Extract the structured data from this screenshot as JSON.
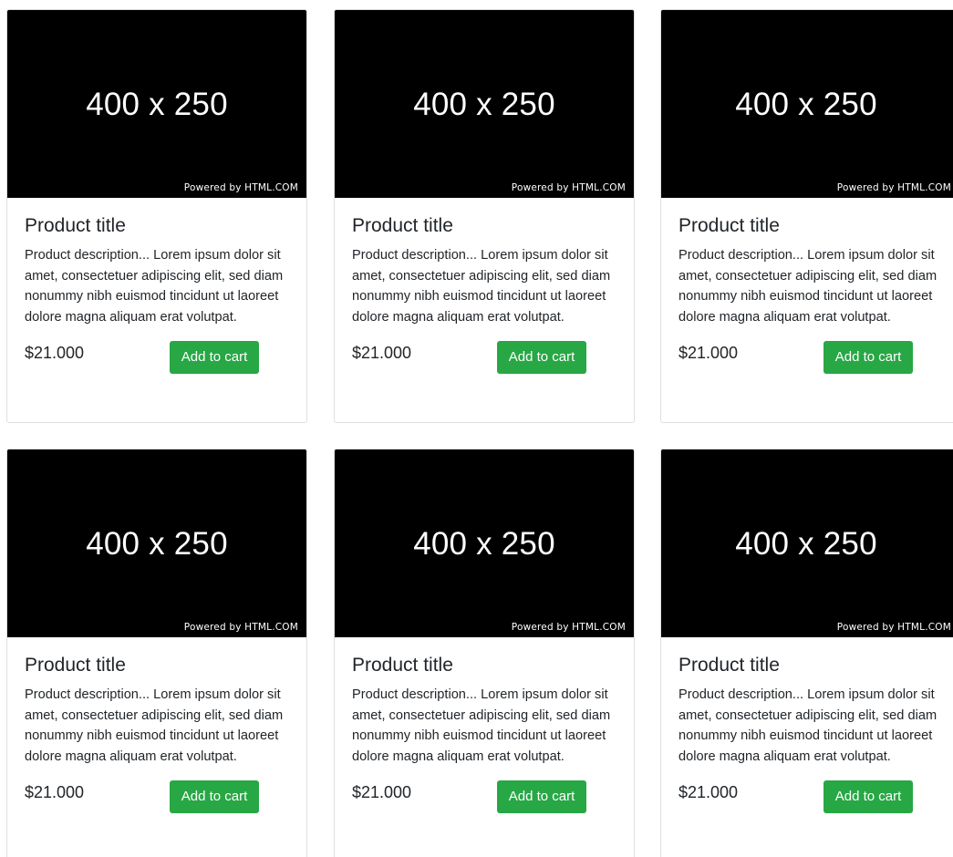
{
  "products": [
    {
      "image_label": "400 x 250",
      "image_credit": "Powered by HTML.COM",
      "title": "Product title",
      "description": "Product description... Lorem ipsum dolor sit amet, consectetuer adipiscing elit, sed diam nonummy nibh euismod tincidunt ut laoreet dolore magna aliquam erat volutpat.",
      "price": "$21.000",
      "button_label": "Add to cart"
    },
    {
      "image_label": "400 x 250",
      "image_credit": "Powered by HTML.COM",
      "title": "Product title",
      "description": "Product description... Lorem ipsum dolor sit amet, consectetuer adipiscing elit, sed diam nonummy nibh euismod tincidunt ut laoreet dolore magna aliquam erat volutpat.",
      "price": "$21.000",
      "button_label": "Add to cart"
    },
    {
      "image_label": "400 x 250",
      "image_credit": "Powered by HTML.COM",
      "title": "Product title",
      "description": "Product description... Lorem ipsum dolor sit amet, consectetuer adipiscing elit, sed diam nonummy nibh euismod tincidunt ut laoreet dolore magna aliquam erat volutpat.",
      "price": "$21.000",
      "button_label": "Add to cart"
    },
    {
      "image_label": "400 x 250",
      "image_credit": "Powered by HTML.COM",
      "title": "Product title",
      "description": "Product description... Lorem ipsum dolor sit amet, consectetuer adipiscing elit, sed diam nonummy nibh euismod tincidunt ut laoreet dolore magna aliquam erat volutpat.",
      "price": "$21.000",
      "button_label": "Add to cart"
    },
    {
      "image_label": "400 x 250",
      "image_credit": "Powered by HTML.COM",
      "title": "Product title",
      "description": "Product description... Lorem ipsum dolor sit amet, consectetuer adipiscing elit, sed diam nonummy nibh euismod tincidunt ut laoreet dolore magna aliquam erat volutpat.",
      "price": "$21.000",
      "button_label": "Add to cart"
    },
    {
      "image_label": "400 x 250",
      "image_credit": "Powered by HTML.COM",
      "title": "Product title",
      "description": "Product description... Lorem ipsum dolor sit amet, consectetuer adipiscing elit, sed diam nonummy nibh euismod tincidunt ut laoreet dolore magna aliquam erat volutpat.",
      "price": "$21.000",
      "button_label": "Add to cart"
    }
  ],
  "colors": {
    "button": "#28a745",
    "image_background": "#000000"
  }
}
